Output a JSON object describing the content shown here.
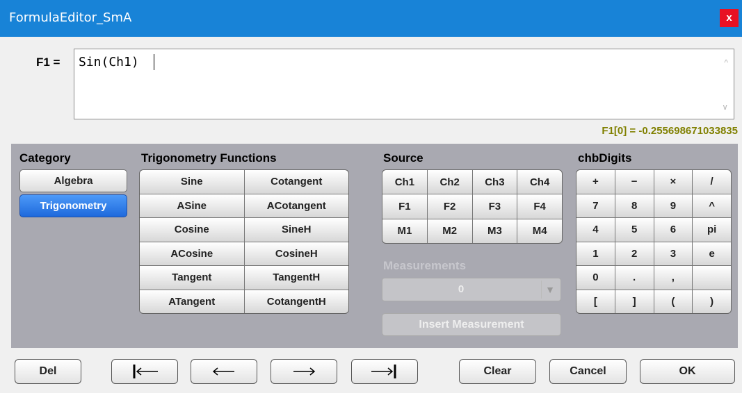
{
  "window": {
    "title": "FormulaEditor_SmA",
    "close_label": "x"
  },
  "formula": {
    "label": "F1 =",
    "expression": "Sin(Ch1)",
    "result": "F1[0] = -0.255698671033835",
    "scroll_up": "^",
    "scroll_down": "v"
  },
  "category": {
    "header": "Category",
    "items": [
      {
        "label": "Algebra",
        "selected": false
      },
      {
        "label": "Trigonometry",
        "selected": true
      }
    ]
  },
  "functions": {
    "header": "Trigonometry Functions",
    "items": [
      "Sine",
      "Cotangent",
      "ASine",
      "ACotangent",
      "Cosine",
      "SineH",
      "ACosine",
      "CosineH",
      "Tangent",
      "TangentH",
      "ATangent",
      "CotangentH"
    ]
  },
  "source": {
    "header": "Source",
    "items": [
      "Ch1",
      "Ch2",
      "Ch3",
      "Ch4",
      "F1",
      "F2",
      "F3",
      "F4",
      "M1",
      "M2",
      "M3",
      "M4"
    ]
  },
  "measurements": {
    "header": "Measurements",
    "selected": "0",
    "insert_label": "Insert Measurement",
    "enabled": false
  },
  "digits": {
    "header": "chbDigits",
    "items": [
      "+",
      "−",
      "×",
      "/",
      "7",
      "8",
      "9",
      "^",
      "4",
      "5",
      "6",
      "pi",
      "1",
      "2",
      "3",
      "e",
      "0",
      ".",
      ",",
      "",
      "[",
      "]",
      "(",
      ")"
    ]
  },
  "bottom": {
    "del": "Del",
    "clear": "Clear",
    "cancel": "Cancel",
    "ok": "OK",
    "icons": [
      "home-arrow-icon",
      "left-arrow-icon",
      "right-arrow-icon",
      "end-arrow-icon"
    ]
  }
}
